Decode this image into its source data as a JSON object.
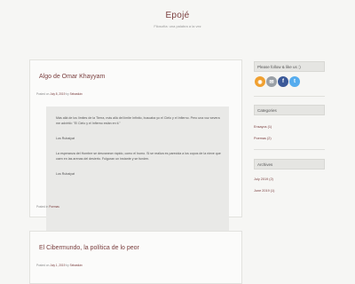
{
  "site": {
    "title": "Epojé",
    "tagline": "Filosofía: una palabra a la vez"
  },
  "posts": [
    {
      "title": "Algo de Omar Khayyam",
      "meta_prefix": "Posted on ",
      "date": "July 8, 2019",
      "meta_by": " by ",
      "author": "Sebastián",
      "quote_paragraphs": [
        "Más allá de los límites de la Tierra, más allá del límite Infinito, buscaba yo el Cielo y el Infierno. Pero una voz severa me advirtió: \"El Cielo y el Infierno están en ti.\"",
        "Los Rubaiyat",
        "La esperanza del Hombre se desvanece rápido, como el humo. Si se realiza es parecida a los copos de la nieve que caen en las arenas del desierto. Fulguran un instante y se funden.",
        "Los Rubaiyat"
      ],
      "filed_prefix": "Posted in ",
      "category": "Poemas"
    },
    {
      "title": "El Cibermundo, la política de lo peor",
      "meta_prefix": "Posted on ",
      "date": "July 1, 2019",
      "meta_by": " by ",
      "author": "Sebastián"
    }
  ],
  "sidebar": {
    "follow": {
      "title": "Please follow & like us :)",
      "icons": [
        {
          "name": "rss-icon",
          "color": "#f0a030",
          "glyph": "◉"
        },
        {
          "name": "email-icon",
          "color": "#9aa0a6",
          "glyph": "✉"
        },
        {
          "name": "facebook-icon",
          "color": "#3b5998",
          "glyph": "f"
        },
        {
          "name": "twitter-icon",
          "color": "#55acee",
          "glyph": "t"
        }
      ]
    },
    "categories": {
      "title": "Categories",
      "items": [
        {
          "label": "Ensayos (1)"
        },
        {
          "label": "Poemas (2)"
        }
      ]
    },
    "archives": {
      "title": "Archives",
      "items": [
        {
          "label": "July 2019 (2)"
        },
        {
          "label": "June 2019 (1)"
        }
      ]
    }
  }
}
